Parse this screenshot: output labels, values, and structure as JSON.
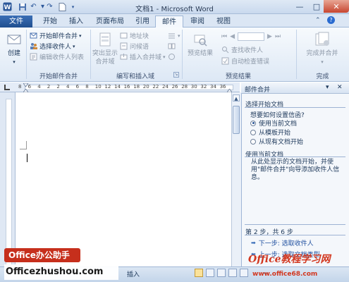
{
  "window": {
    "title": "文档1 - Microsoft Word",
    "controls": [
      "minimize",
      "maximize",
      "close"
    ]
  },
  "quick_access": [
    "word-logo",
    "save",
    "undo",
    "redo",
    "new-document",
    "customize"
  ],
  "tabs": [
    {
      "label": "文件",
      "active": false
    },
    {
      "label": "开始",
      "active": false
    },
    {
      "label": "插入",
      "active": false
    },
    {
      "label": "页面布局",
      "active": false
    },
    {
      "label": "引用",
      "active": false
    },
    {
      "label": "邮件",
      "active": true
    },
    {
      "label": "审阅",
      "active": false
    },
    {
      "label": "视图",
      "active": false
    }
  ],
  "ribbon": {
    "create": {
      "label": "创建"
    },
    "start_merge": {
      "group_label": "开始邮件合并",
      "start_btn": "开始邮件合并",
      "select_recipients": "选择收件人",
      "edit_recipients": "编辑收件人列表"
    },
    "write_insert": {
      "group_label": "编写和插入域",
      "highlight": "突出显示合并域",
      "address_block": "地址块",
      "greeting_line": "问候语",
      "insert_field": "插入合并域"
    },
    "preview": {
      "group_label": "预览结果",
      "preview_btn": "预览结果",
      "find_recipient": "查找收件人",
      "auto_check": "自动检查错误"
    },
    "finish": {
      "group_label": "完成",
      "finish_btn": "完成并合并"
    }
  },
  "ruler": {
    "h_numbers": [
      "8",
      "6",
      "4",
      "2",
      "2",
      "4",
      "6",
      "8",
      "10",
      "12",
      "14",
      "16",
      "18",
      "20",
      "22",
      "24",
      "26",
      "28",
      "30",
      "32",
      "34",
      "36"
    ]
  },
  "task_pane": {
    "title": "邮件合并",
    "select_doc_heading": "选择开始文档",
    "question": "想要如何设置信函?",
    "options": [
      {
        "label": "使用当前文档",
        "selected": true
      },
      {
        "label": "从模板开始",
        "selected": false
      },
      {
        "label": "从现有文档开始",
        "selected": false
      }
    ],
    "current_heading": "使用当前文档",
    "description": "从此处显示的文档开始，并使用\"邮件合并\"向导添加收件人信息。",
    "step": "第 2 步，共 6 步",
    "next": "下一步: 选取收件人",
    "prev": "上一步: 选取文档类型"
  },
  "status_bar": {
    "insert_label": "插入"
  },
  "watermarks": {
    "badge": "Office办公助手",
    "site": "Officezhushou.com",
    "right_logo": "Office教程学习网",
    "right_url": "www.office68.com"
  }
}
